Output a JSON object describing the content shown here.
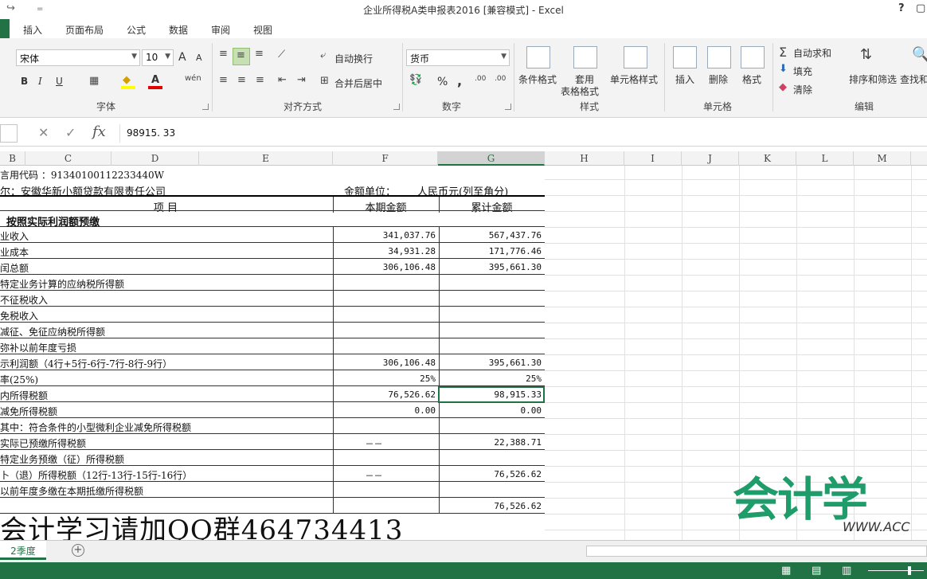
{
  "titlebar": {
    "title": "企业所得税A类申报表2016  [兼容模式] - Excel",
    "help": "?",
    "restore": "▢",
    "minimize": "—",
    "close": "✕",
    "qat_redo": "↪",
    "qat_more": "="
  },
  "tabs": [
    "插入",
    "页面布局",
    "公式",
    "数据",
    "审阅",
    "视图"
  ],
  "ribbon": {
    "font": {
      "name": "宋体",
      "size": "10",
      "grow": "A",
      "shrink": "A",
      "bold": "B",
      "italic": "I",
      "underline": "U",
      "label": "字体"
    },
    "alignment": {
      "wrap": "自动换行",
      "merge": "合并后居中",
      "label": "对齐方式"
    },
    "number": {
      "format": "货币",
      "percent": "%",
      "comma": ",",
      "label": "数字"
    },
    "styles": {
      "conditional": "条件格式",
      "table_line1": "套用",
      "table_line2": "表格格式",
      "cell_styles": "单元格样式",
      "label": "样式"
    },
    "cells": {
      "insert": "插入",
      "delete": "删除",
      "format": "格式",
      "label": "单元格"
    },
    "editing": {
      "autosum": "自动求和",
      "fill": "填充",
      "clear": "清除",
      "sort": "排序和筛选",
      "find": "查找和",
      "label": "编辑"
    }
  },
  "formula_bar": {
    "fx": "fx",
    "value": "98915. 33"
  },
  "columns": [
    "B",
    "C",
    "D",
    "E",
    "F",
    "G",
    "H",
    "I",
    "J",
    "K",
    "L",
    "M"
  ],
  "sheet": {
    "credit_code": "言用代码 ：91340100112233440W",
    "taxpayer": "尔：安徽华新小额贷款有限责任公司",
    "unit_label": "金额单位：",
    "unit_value": "人民币元(列至角分)",
    "header": {
      "item": "项          目",
      "current": "本期金额",
      "cumulative": "累计金额"
    },
    "section": "按照实际利润额预缴",
    "rows": [
      {
        "label": "业收入",
        "f": "341,037.76",
        "g": "567,437.76"
      },
      {
        "label": "业成本",
        "f": "34,931.28",
        "g": "171,776.46"
      },
      {
        "label": "闰总额",
        "f": "306,106.48",
        "g": "395,661.30"
      },
      {
        "label": "  特定业务计算的应纳税所得额",
        "f": "",
        "g": ""
      },
      {
        "label": "  不征税收入",
        "f": "",
        "g": ""
      },
      {
        "label": "  免税收入",
        "f": "",
        "g": ""
      },
      {
        "label": "  减征、免征应纳税所得额",
        "f": "",
        "g": ""
      },
      {
        "label": "  弥补以前年度亏损",
        "f": "",
        "g": ""
      },
      {
        "label": "示利润额（4行+5行-6行-7行-8行-9行）",
        "f": "306,106.48",
        "g": "395,661.30"
      },
      {
        "label": "率(25%)",
        "f": "25%",
        "g": "25%"
      },
      {
        "label": "内所得税额",
        "f": "76,526.62",
        "g": "98,915.33"
      },
      {
        "label": "  减免所得税额",
        "f": "0.00",
        "g": "0.00"
      },
      {
        "label": "  其中：符合条件的小型微利企业减免所得税额",
        "f": "",
        "g": ""
      },
      {
        "label": "  实际已预缴所得税额",
        "f": "－－",
        "g": "22,388.71"
      },
      {
        "label": "  特定业务预缴（征）所得税额",
        "f": "",
        "g": ""
      },
      {
        "label": "卜（退）所得税额（12行-13行-15行-16行）",
        "f": "－－",
        "g": "76,526.62"
      },
      {
        "label": "  以前年度多缴在本期抵缴所得税额",
        "f": "",
        "g": ""
      },
      {
        "label": "  ",
        "f": "",
        "g": "76,526.62"
      }
    ]
  },
  "watermark": {
    "qq": "会计学习请加QQ群464734413",
    "logo": "会计学",
    "www": "WWW.ACC"
  },
  "sheet_tabs": {
    "active": "2季度",
    "add": "+"
  }
}
